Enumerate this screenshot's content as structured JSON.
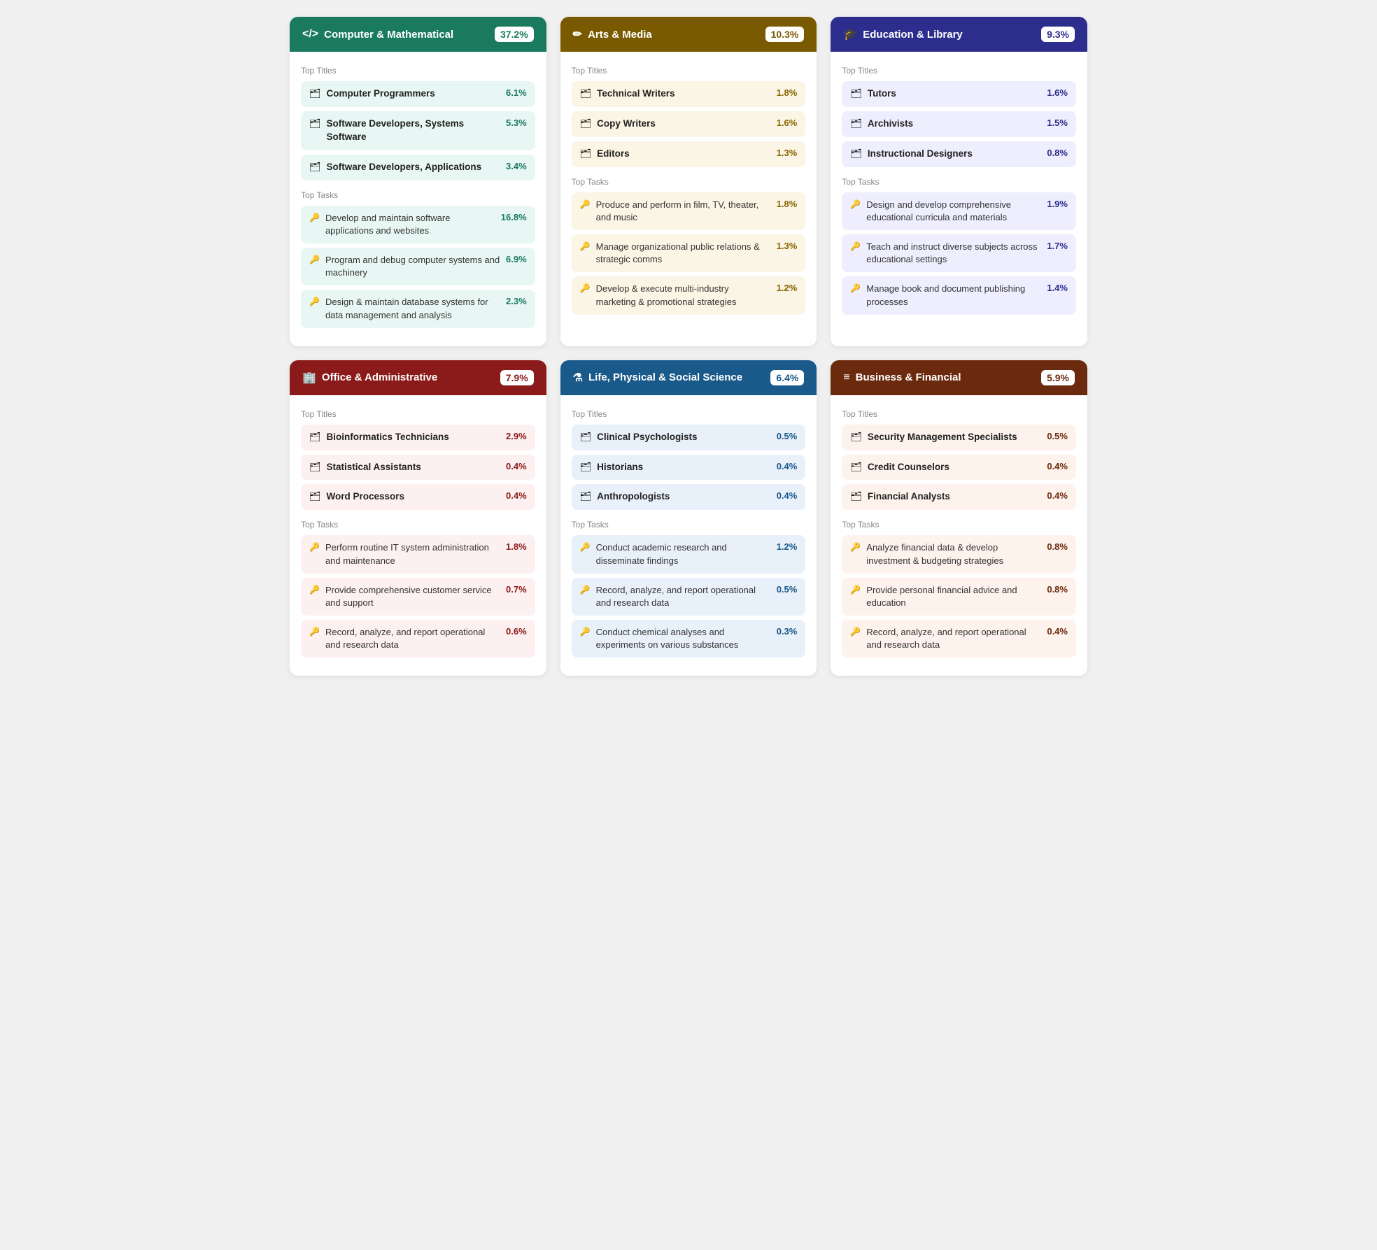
{
  "cards": [
    {
      "id": "computer-mathematical",
      "icon": "</>",
      "title": "Computer & Mathematical",
      "percentage": "37.2%",
      "header_bg": "#1a7a5e",
      "badge_color": "#1a7a5e",
      "title_bg_light": "#e8f7f3",
      "item_bg": "#e8f7f3",
      "task_bg": "#e8f7f3",
      "pct_color": "#1a7a5e",
      "titles": [
        {
          "name": "Computer Programmers",
          "pct": "6.1%"
        },
        {
          "name": "Software Developers, Systems Software",
          "pct": "5.3%"
        },
        {
          "name": "Software Developers, Applications",
          "pct": "3.4%"
        }
      ],
      "tasks": [
        {
          "name": "Develop and maintain software applications and websites",
          "pct": "16.8%"
        },
        {
          "name": "Program and debug computer systems and machinery",
          "pct": "6.9%"
        },
        {
          "name": "Design & maintain database systems for data management and analysis",
          "pct": "2.3%"
        }
      ]
    },
    {
      "id": "arts-media",
      "icon": "✏",
      "title": "Arts & Media",
      "percentage": "10.3%",
      "header_bg": "#7a5a00",
      "badge_color": "#7a5a00",
      "title_bg_light": "#faf5e4",
      "item_bg": "#faf5e4",
      "task_bg": "#faf5e4",
      "pct_color": "#8a6500",
      "titles": [
        {
          "name": "Technical Writers",
          "pct": "1.8%"
        },
        {
          "name": "Copy Writers",
          "pct": "1.6%"
        },
        {
          "name": "Editors",
          "pct": "1.3%"
        }
      ],
      "tasks": [
        {
          "name": "Produce and perform in film, TV, theater, and music",
          "pct": "1.8%"
        },
        {
          "name": "Manage organizational public relations & strategic comms",
          "pct": "1.3%"
        },
        {
          "name": "Develop & execute multi-industry marketing & promotional strategies",
          "pct": "1.2%"
        }
      ]
    },
    {
      "id": "education-library",
      "icon": "🎓",
      "title": "Education & Library",
      "percentage": "9.3%",
      "header_bg": "#2d2d8e",
      "badge_color": "#2d2d8e",
      "title_bg_light": "#eeeeff",
      "item_bg": "#eeeeff",
      "task_bg": "#eeeeff",
      "pct_color": "#2d2d8e",
      "titles": [
        {
          "name": "Tutors",
          "pct": "1.6%"
        },
        {
          "name": "Archivists",
          "pct": "1.5%"
        },
        {
          "name": "Instructional Designers",
          "pct": "0.8%"
        }
      ],
      "tasks": [
        {
          "name": "Design and develop comprehensive educational curricula and materials",
          "pct": "1.9%"
        },
        {
          "name": "Teach and instruct diverse subjects across educational settings",
          "pct": "1.7%"
        },
        {
          "name": "Manage book and document publishing processes",
          "pct": "1.4%"
        }
      ]
    },
    {
      "id": "office-administrative",
      "icon": "🏢",
      "title": "Office & Administrative",
      "percentage": "7.9%",
      "header_bg": "#8b1a1a",
      "badge_color": "#8b1a1a",
      "title_bg_light": "#fdf0f0",
      "item_bg": "#fdf0f0",
      "task_bg": "#fdf0f0",
      "pct_color": "#8b1a1a",
      "titles": [
        {
          "name": "Bioinformatics Technicians",
          "pct": "2.9%"
        },
        {
          "name": "Statistical Assistants",
          "pct": "0.4%"
        },
        {
          "name": "Word Processors",
          "pct": "0.4%"
        }
      ],
      "tasks": [
        {
          "name": "Perform routine IT system administration and maintenance",
          "pct": "1.8%"
        },
        {
          "name": "Provide comprehensive customer service and support",
          "pct": "0.7%"
        },
        {
          "name": "Record, analyze, and report operational and research data",
          "pct": "0.6%"
        }
      ]
    },
    {
      "id": "life-physical-social-science",
      "icon": "⚗",
      "title": "Life, Physical & Social Science",
      "percentage": "6.4%",
      "header_bg": "#1a5a8a",
      "badge_color": "#1a5a8a",
      "title_bg_light": "#e8f0fa",
      "item_bg": "#e8f0fa",
      "task_bg": "#e8f0fa",
      "pct_color": "#1a5a8a",
      "titles": [
        {
          "name": "Clinical Psychologists",
          "pct": "0.5%"
        },
        {
          "name": "Historians",
          "pct": "0.4%"
        },
        {
          "name": "Anthropologists",
          "pct": "0.4%"
        }
      ],
      "tasks": [
        {
          "name": "Conduct academic research and disseminate findings",
          "pct": "1.2%"
        },
        {
          "name": "Record, analyze, and report operational and research data",
          "pct": "0.5%"
        },
        {
          "name": "Conduct chemical analyses and experiments on various substances",
          "pct": "0.3%"
        }
      ]
    },
    {
      "id": "business-financial",
      "icon": "≡",
      "title": "Business & Financial",
      "percentage": "5.9%",
      "header_bg": "#6b2a0e",
      "badge_color": "#6b2a0e",
      "title_bg_light": "#fdf2ec",
      "item_bg": "#fdf2ec",
      "task_bg": "#fdf2ec",
      "pct_color": "#6b2a0e",
      "titles": [
        {
          "name": "Security Management Specialists",
          "pct": "0.5%"
        },
        {
          "name": "Credit Counselors",
          "pct": "0.4%"
        },
        {
          "name": "Financial Analysts",
          "pct": "0.4%"
        }
      ],
      "tasks": [
        {
          "name": "Analyze financial data & develop investment & budgeting strategies",
          "pct": "0.8%"
        },
        {
          "name": "Provide personal financial advice and education",
          "pct": "0.8%"
        },
        {
          "name": "Record, analyze, and report operational and research data",
          "pct": "0.4%"
        }
      ]
    }
  ],
  "labels": {
    "top_titles": "Top Titles",
    "top_tasks": "Top Tasks"
  }
}
